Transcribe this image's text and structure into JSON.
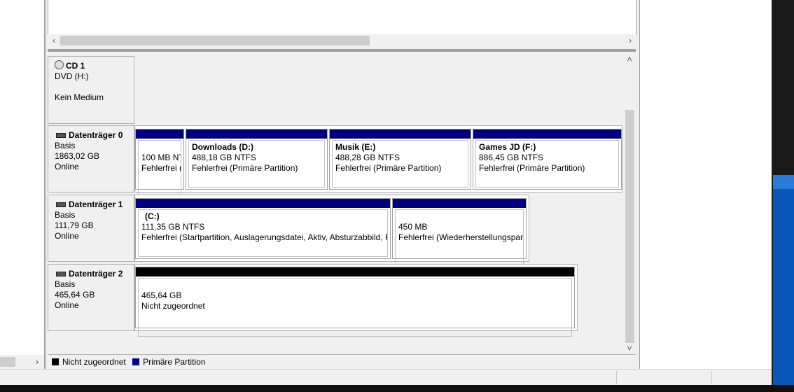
{
  "disks": [
    {
      "title": "CD 1",
      "kind": "cd",
      "lines": [
        "DVD (H:)",
        "",
        "Kein Medium"
      ]
    },
    {
      "title": "Datenträger 0",
      "kind": "disk",
      "lines": [
        "Basis",
        "1863,02 GB",
        "Online"
      ],
      "partitions": [
        {
          "name": "",
          "size": "100 MB NT",
          "status": "Fehlerfrei ("
        },
        {
          "name": "Downloads  (D:)",
          "size": "488,18 GB NTFS",
          "status": "Fehlerfrei (Primäre Partition)"
        },
        {
          "name": "Musik  (E:)",
          "size": "488,28 GB NTFS",
          "status": "Fehlerfrei (Primäre Partition)"
        },
        {
          "name": "Games JD  (F:)",
          "size": "886,45 GB NTFS",
          "status": "Fehlerfrei (Primäre Partition)"
        }
      ]
    },
    {
      "title": "Datenträger 1",
      "kind": "disk",
      "lines": [
        "Basis",
        "111,79 GB",
        "Online"
      ],
      "partitions": [
        {
          "name": "(C:)",
          "size": "111,35 GB NTFS",
          "status": "Fehlerfrei (Startpartition, Auslagerungsdatei, Aktiv, Absturzabbild, P"
        },
        {
          "name": "",
          "size": "450 MB",
          "status": "Fehlerfrei (Wiederherstellungspart"
        }
      ]
    },
    {
      "title": "Datenträger 2",
      "kind": "disk",
      "lines": [
        "Basis",
        "465,64 GB",
        "Online"
      ],
      "partitions": [
        {
          "name": "",
          "size": "465,64 GB",
          "status": "Nicht zugeordnet"
        }
      ]
    }
  ],
  "legend": [
    {
      "label": "Nicht zugeordnet",
      "color": "#000000"
    },
    {
      "label": "Primäre Partition",
      "color": "#000080"
    }
  ],
  "icons": {
    "scroll_left": "chevron-left-icon",
    "scroll_right": "chevron-right-icon",
    "scroll_up": "chevron-up-icon",
    "scroll_down": "chevron-down-icon"
  }
}
